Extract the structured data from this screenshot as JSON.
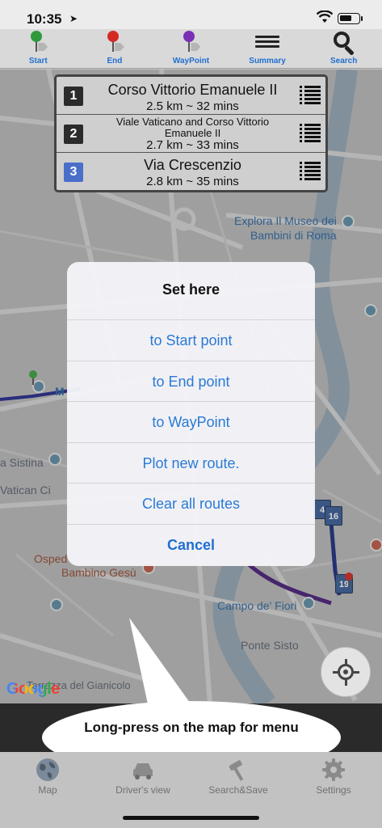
{
  "status_bar": {
    "time": "10:35",
    "location_arrow": "➤"
  },
  "toolbar": {
    "items": [
      {
        "label": "Start",
        "icon": "green-pin-icon",
        "color": "#2f9a3c"
      },
      {
        "label": "End",
        "icon": "red-pin-icon",
        "color": "#d42a22"
      },
      {
        "label": "WayPoint",
        "icon": "purple-pin-icon",
        "color": "#7a2fb5"
      },
      {
        "label": "Summary",
        "icon": "list-icon"
      },
      {
        "label": "Search",
        "icon": "search-icon"
      }
    ]
  },
  "routes": [
    {
      "number": "1",
      "name": "Corso Vittorio Emanuele II",
      "info": "2.5 km  ~ 32 mins",
      "badge_color": "#2b2b2b"
    },
    {
      "number": "2",
      "name": "Viale Vaticano and Corso Vittorio Emanuele II",
      "info": "2.7 km  ~ 33 mins",
      "badge_color": "#2b2b2b"
    },
    {
      "number": "3",
      "name": "Via Crescenzio",
      "info": "2.8 km  ~ 35 mins",
      "badge_color": "#4a6fc9"
    }
  ],
  "map": {
    "labels": {
      "museum": "Explora Il Museo dei",
      "museum2": "Bambini di Roma",
      "sistina": "a Sistina",
      "vatican": "Vatican Ci",
      "ospedale": "Osped",
      "bambino": "Bambino Gesù",
      "campo": "Campo de' Fiori",
      "sisto": "Ponte Sisto",
      "gianicolo": "Terrazza del Gianicolo",
      "m_letter": "M"
    },
    "markers": [
      "4",
      "16",
      "19"
    ],
    "google_logo": "Google"
  },
  "action_sheet": {
    "title": "Set here",
    "options": [
      "to Start point",
      "to End point",
      "to WayPoint",
      "Plot new route.",
      "Clear all routes"
    ],
    "cancel": "Cancel"
  },
  "hint": "Long-press on the map for menu",
  "tabbar": {
    "items": [
      {
        "label": "Map",
        "icon": "globe-icon"
      },
      {
        "label": "Driver's view",
        "icon": "car-icon"
      },
      {
        "label": "Search&Save",
        "icon": "hammer-icon"
      },
      {
        "label": "Settings",
        "icon": "gear-icon"
      }
    ]
  }
}
